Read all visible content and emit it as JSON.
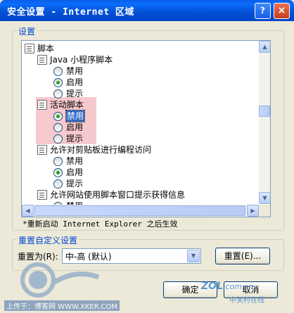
{
  "window": {
    "title": "安全设置 - Internet 区域",
    "help_btn": "?",
    "close_btn": "×"
  },
  "settings_group": {
    "label": "设置",
    "items": [
      {
        "kind": "category",
        "text": "脚本"
      },
      {
        "kind": "category",
        "text": "Java 小程序脚本"
      },
      {
        "kind": "option",
        "text": "禁用",
        "selected": false
      },
      {
        "kind": "option",
        "text": "启用",
        "selected": true
      },
      {
        "kind": "option",
        "text": "提示",
        "selected": false
      },
      {
        "kind": "category",
        "text": "活动脚本"
      },
      {
        "kind": "option",
        "text": "禁用",
        "selected": true,
        "focused": true
      },
      {
        "kind": "option",
        "text": "启用",
        "selected": false
      },
      {
        "kind": "option",
        "text": "提示",
        "selected": false
      },
      {
        "kind": "category",
        "text": "允许对剪贴板进行编程访问"
      },
      {
        "kind": "option",
        "text": "禁用",
        "selected": false
      },
      {
        "kind": "option",
        "text": "启用",
        "selected": true
      },
      {
        "kind": "option",
        "text": "提示",
        "selected": false
      },
      {
        "kind": "category",
        "text": "允许网站使用脚本窗口提示获得信息"
      },
      {
        "kind": "option",
        "text": "禁用",
        "selected": false
      }
    ],
    "restart_note": "*重新启动 Internet Explorer 之后生效"
  },
  "reset_group": {
    "label": "重置自定义设置",
    "reset_to_label": "重置为(R):",
    "reset_value": "中-高 (默认)",
    "reset_button": "重置(E)..."
  },
  "footer": {
    "ok_button": "确定",
    "cancel_button": "取消"
  },
  "watermarks": {
    "site_logo": "ZOL",
    "site_domain": ".com.cn",
    "site_name": "中关村在线",
    "upload_text": "上传于：博客网 WWW.XKER.COM"
  }
}
